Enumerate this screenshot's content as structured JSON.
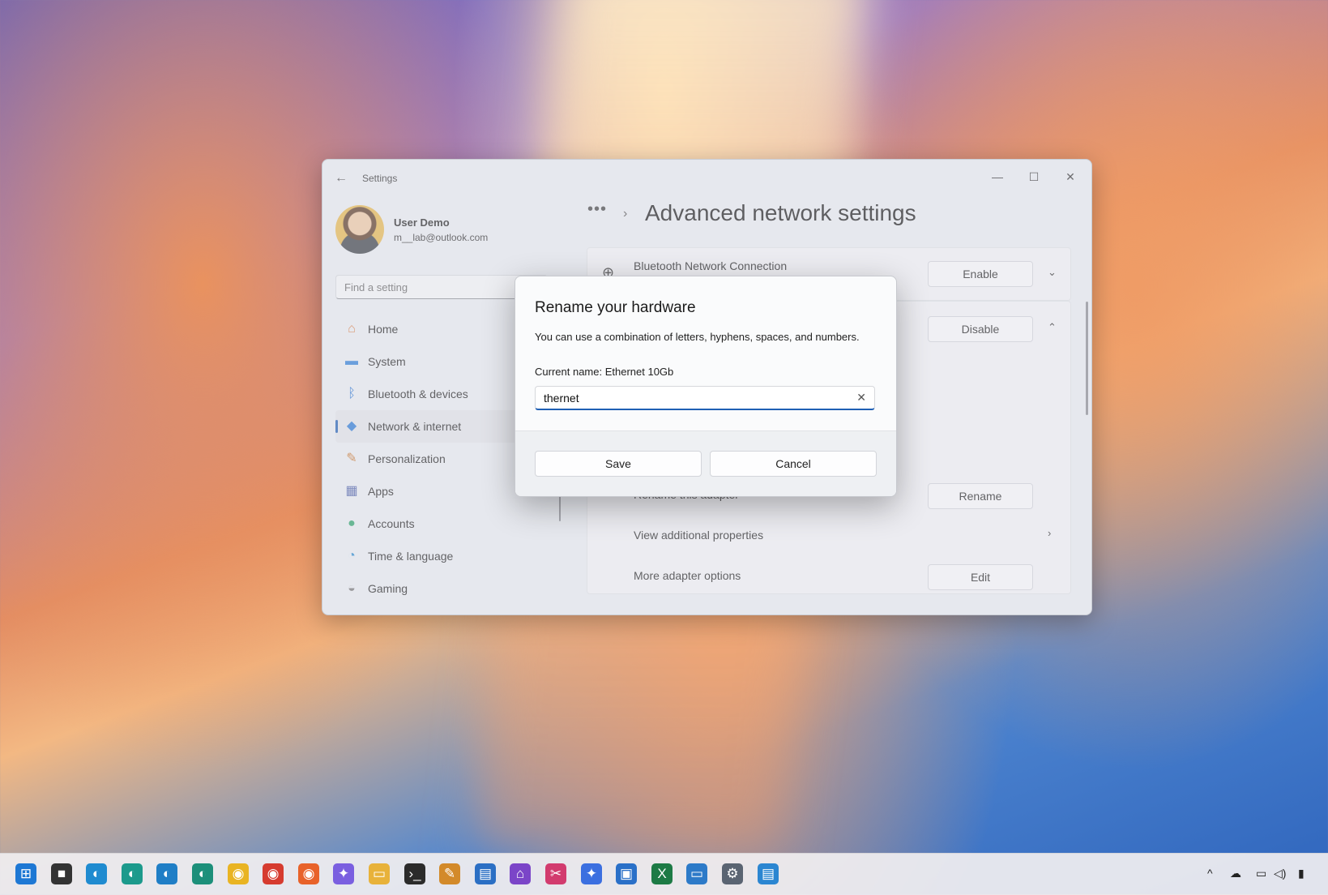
{
  "window": {
    "title": "Settings",
    "back_icon": "←",
    "minimize_icon": "—",
    "maximize_icon": "☐",
    "close_icon": "✕"
  },
  "profile": {
    "name": "User Demo",
    "email": "m__lab@outlook.com"
  },
  "search": {
    "placeholder": "Find a setting"
  },
  "nav": {
    "items": [
      {
        "label": "Home",
        "icon": "home-icon",
        "glyph": "⌂",
        "color": "#d9793b"
      },
      {
        "label": "System",
        "icon": "system-icon",
        "glyph": "▬",
        "color": "#2f7fd8"
      },
      {
        "label": "Bluetooth & devices",
        "icon": "bluetooth-icon",
        "glyph": "ᛒ",
        "color": "#1f6fd1"
      },
      {
        "label": "Network & internet",
        "icon": "wifi-icon",
        "glyph": "◆",
        "color": "#2c7ad6"
      },
      {
        "label": "Personalization",
        "icon": "brush-icon",
        "glyph": "✎",
        "color": "#c9762c"
      },
      {
        "label": "Apps",
        "icon": "apps-icon",
        "glyph": "▦",
        "color": "#4b5fa8"
      },
      {
        "label": "Accounts",
        "icon": "person-icon",
        "glyph": "●",
        "color": "#2da46b"
      },
      {
        "label": "Time & language",
        "icon": "clock-globe-icon",
        "glyph": "◔",
        "color": "#2a8bd0"
      },
      {
        "label": "Gaming",
        "icon": "gamepad-icon",
        "glyph": "◒",
        "color": "#777"
      }
    ],
    "active_index": 3
  },
  "breadcrumb": {
    "more": "•••",
    "separator": "›"
  },
  "page_title": "Advanced network settings",
  "adapters": {
    "bluetooth_name": "Bluetooth Network Connection",
    "enable_label": "Enable",
    "disable_label": "Disable",
    "rename_row": "Rename this adapter",
    "rename_button": "Rename",
    "view_props": "View additional properties",
    "more_options": "More adapter options",
    "edit_button": "Edit"
  },
  "dialog": {
    "title": "Rename your hardware",
    "description": "You can use a combination of letters, hyphens, spaces, and numbers.",
    "current_name": "Current name: Ethernet 10Gb",
    "input_value": "thernet",
    "clear_icon": "✕",
    "save_label": "Save",
    "cancel_label": "Cancel"
  },
  "taskbar": {
    "icons": [
      {
        "name": "start-icon",
        "glyph": "⊞",
        "color": "#1e78d4"
      },
      {
        "name": "task-view-icon",
        "glyph": "■",
        "color": "#333"
      },
      {
        "name": "edge-icon",
        "glyph": "◐",
        "color": "#1f8bd0"
      },
      {
        "name": "edge-canary-icon",
        "glyph": "◐",
        "color": "#1c9a8c"
      },
      {
        "name": "edge-beta-icon",
        "glyph": "◐",
        "color": "#1f7ec6"
      },
      {
        "name": "edge-dev-icon",
        "glyph": "◐",
        "color": "#1c8f7a"
      },
      {
        "name": "chrome-canary-icon",
        "glyph": "◉",
        "color": "#e9b423"
      },
      {
        "name": "chrome-icon",
        "glyph": "◉",
        "color": "#d63b2f"
      },
      {
        "name": "firefox-icon",
        "glyph": "◉",
        "color": "#e8622a"
      },
      {
        "name": "copilot-icon",
        "glyph": "✦",
        "color": "#7a5fe0"
      },
      {
        "name": "file-explorer-icon",
        "glyph": "▭",
        "color": "#e8b23a"
      },
      {
        "name": "terminal-icon",
        "glyph": "›_",
        "color": "#2b2b2b"
      },
      {
        "name": "notepad-plus-icon",
        "glyph": "✎",
        "color": "#d38a2a"
      },
      {
        "name": "document-icon",
        "glyph": "▤",
        "color": "#2b6fc4"
      },
      {
        "name": "dev-home-icon",
        "glyph": "⌂",
        "color": "#7b45c8"
      },
      {
        "name": "snipping-tool-icon",
        "glyph": "✂",
        "color": "#d23b6e"
      },
      {
        "name": "copilot-star-icon",
        "glyph": "✦",
        "color": "#3b6fe0"
      },
      {
        "name": "store-icon",
        "glyph": "▣",
        "color": "#2a70c8"
      },
      {
        "name": "excel-icon",
        "glyph": "X",
        "color": "#1d7a45"
      },
      {
        "name": "monitor-icon",
        "glyph": "▭",
        "color": "#2d7ac8"
      },
      {
        "name": "settings-icon",
        "glyph": "⚙",
        "color": "#5a6472"
      },
      {
        "name": "notepad-icon",
        "glyph": "▤",
        "color": "#2b86d1"
      }
    ],
    "tray": {
      "chevron": "^",
      "onedrive": "☁",
      "network": "▭",
      "volume": "◁)",
      "battery": "▮"
    }
  }
}
